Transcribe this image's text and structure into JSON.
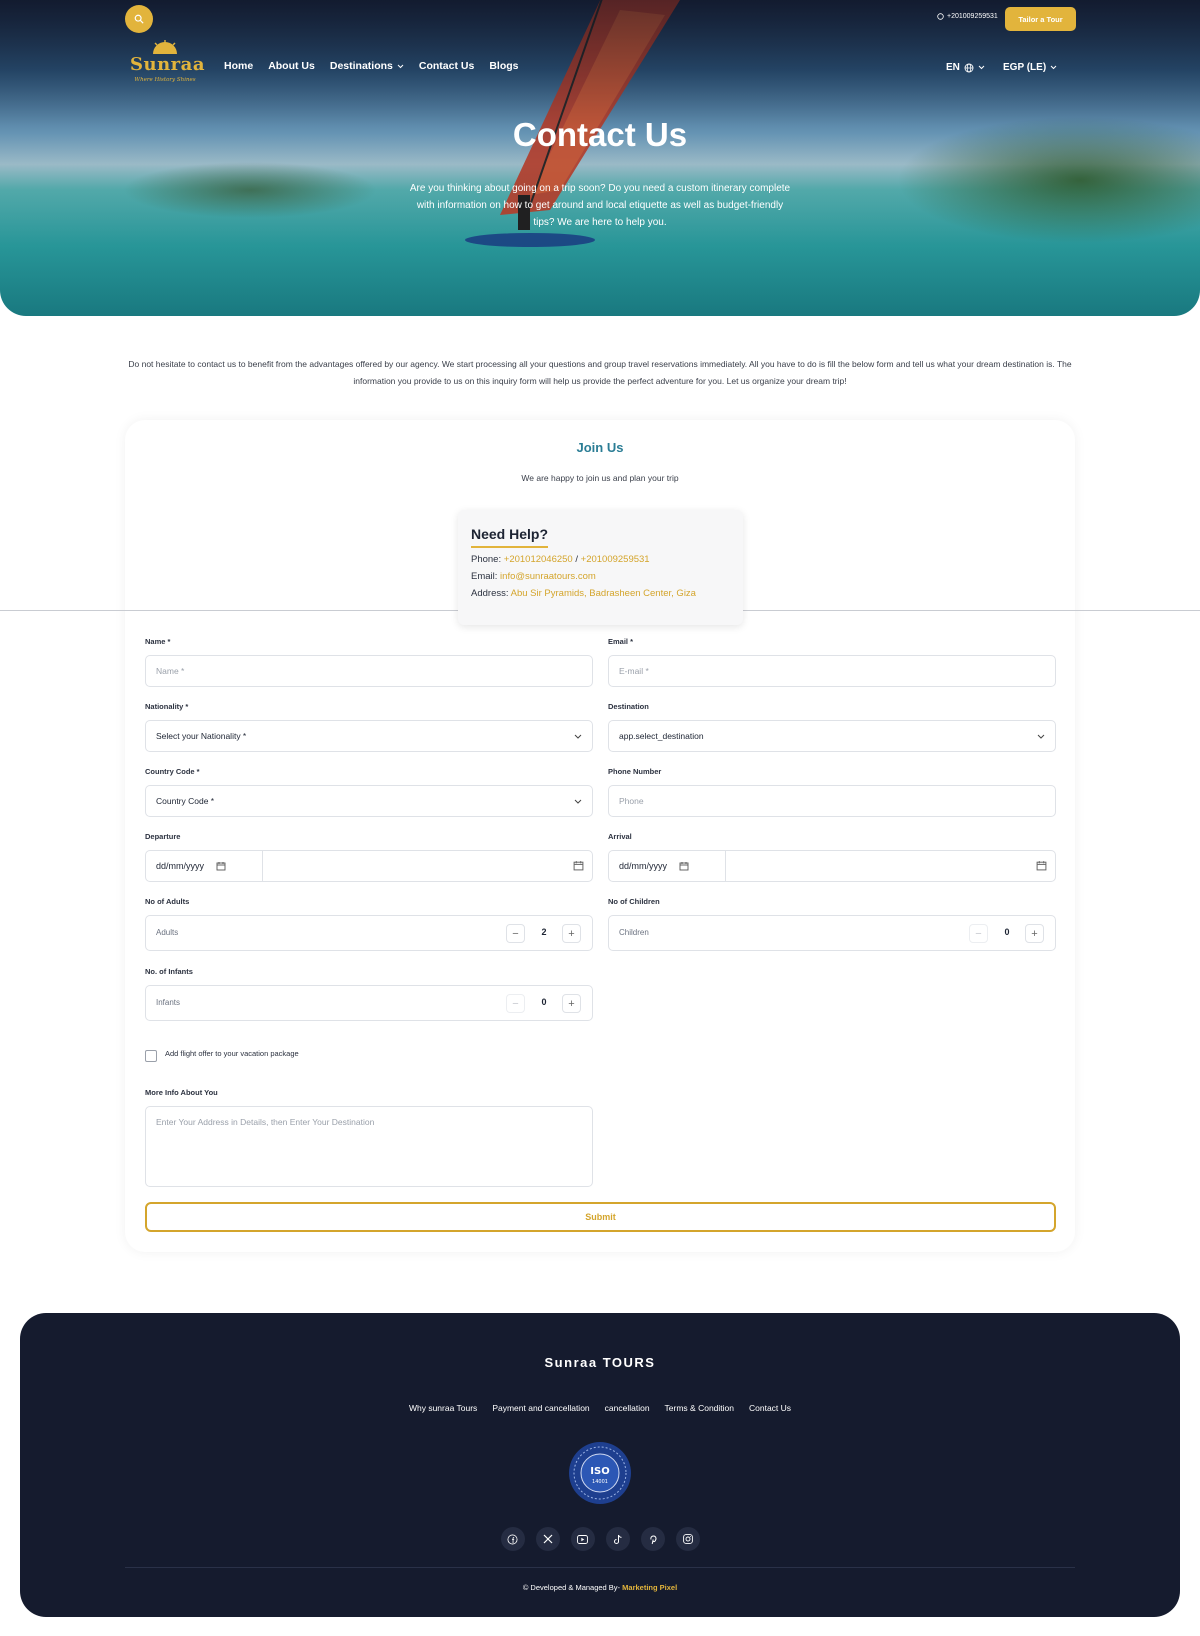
{
  "header": {
    "phone": "+201009259531",
    "tailor_button": "Tailor a Tour",
    "logo_word": "Sunraa",
    "logo_tagline": "Where History Shines",
    "nav": [
      {
        "label": "Home"
      },
      {
        "label": "About Us"
      },
      {
        "label": "Destinations"
      },
      {
        "label": "Contact Us"
      },
      {
        "label": "Blogs"
      }
    ],
    "language": "EN",
    "currency": "EGP (LE)"
  },
  "hero": {
    "title": "Contact Us",
    "text": "Are you thinking about going on a trip soon? Do you need a custom itinerary complete with information on how to get around and local etiquette as well as budget-friendly tips? We are here to help you."
  },
  "intro": "Do not hesitate to contact us to benefit from the advantages offered by our agency. We start processing all your questions and group travel reservations immediately. All you have to do is fill the below form and tell us what your dream destination is. The information you provide to us on this inquiry form will help us provide the perfect adventure for you. Let us organize your dream trip!",
  "join": {
    "title": "Join Us",
    "subtitle": "We are happy to join us and plan your trip"
  },
  "help": {
    "title": "Need Help?",
    "phone_label": "Phone:",
    "phone_1": "+201012046250",
    "phone_sep": "/",
    "phone_2": "+201009259531",
    "email_label": "Email:",
    "email": "info@sunraatours.com",
    "address_label": "Address:",
    "address": "Abu Sir Pyramids, Badrasheen Center, Giza"
  },
  "form": {
    "name_label": "Name *",
    "name_placeholder": "Name *",
    "email_label": "Email *",
    "email_placeholder": "E-mail *",
    "nationality_label": "Nationality *",
    "nationality_value": "Select your Nationality *",
    "destination_label": "Destination",
    "destination_value": "app.select_destination",
    "country_code_label": "Country Code *",
    "country_code_value": "Country Code *",
    "phone_label": "Phone Number",
    "phone_placeholder": "Phone",
    "departure_label": "Departure",
    "departure_placeholder": "dd/mm/yyyy",
    "arrival_label": "Arrival",
    "arrival_placeholder": "dd/mm/yyyy",
    "adults_label": "No of Adults",
    "adults_inner": "Adults",
    "adults_value": "2",
    "children_label": "No of Children",
    "children_inner": "Children",
    "children_value": "0",
    "infants_label": "No. of Infants",
    "infants_inner": "Infants",
    "infants_value": "0",
    "flight_checkbox_label": "Add flight offer to your vacation package",
    "more_info_label": "More Info About You",
    "more_info_placeholder": "Enter Your Address in Details, then Enter Your Destination",
    "submit_label": "Submit"
  },
  "footer": {
    "brand": "Sunraa TOURS",
    "links": [
      {
        "label": "Why sunraa Tours"
      },
      {
        "label": "Payment and cancellation"
      },
      {
        "label": "cancellation"
      },
      {
        "label": "Terms & Condition"
      },
      {
        "label": "Contact Us"
      }
    ],
    "iso_text": "ISO",
    "iso_number": "14001",
    "socials": [
      "facebook-icon",
      "x-icon",
      "youtube-icon",
      "tiktok-icon",
      "pinterest-icon",
      "instagram-icon"
    ],
    "copyright_prefix": "© Developed & Managed By-",
    "copyright_company": "Marketing Pixel"
  },
  "colors": {
    "gold": "#e2b43c",
    "teal_heading": "#2b7d95",
    "footer_bg": "#151b2e"
  }
}
